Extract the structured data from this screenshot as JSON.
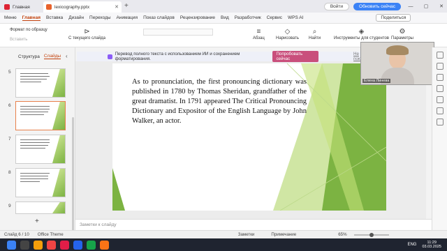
{
  "titlebar": {
    "home_tab": "Главная",
    "file_tab": "lexicography.pptx",
    "login": "Войти",
    "update": "Обновить сейчас"
  },
  "menu": {
    "items": [
      "Меню",
      "Главная",
      "Вставка",
      "Дизайн",
      "Переходы",
      "Анимация",
      "Показ слайдов",
      "Рецензирование",
      "Вид",
      "Разработчик",
      "Сервис",
      "WPS AI"
    ],
    "share": "Поделиться"
  },
  "ribbon": {
    "format_painter": "Формат по образцу",
    "paste": "Вставить",
    "from_current": "С текущего слайда",
    "paragraph": "Абзац",
    "draw": "Нарисовать",
    "find": "Найти",
    "tools_students": "Инструменты для студентов",
    "parameters": "Параметры"
  },
  "left_panel": {
    "tabs": [
      "Структура",
      "Слайды"
    ],
    "slide_numbers": [
      "5",
      "6",
      "7",
      "8",
      "9"
    ]
  },
  "notice": {
    "text": "Перевод полного текста с использованием ИИ и сохранением форматирования.",
    "button": "Попробовать сейчас",
    "dismiss": "Не показ"
  },
  "slide": {
    "body": "As to pronunciation, the first pronouncing dictionary was published in 1780 by Thomas Sheridan, grandfather of the great dramatist. In 1791 appeared The Critical Pronouncing Dictionary and Expositor of the English Language by John Walker, an actor."
  },
  "video": {
    "name": "Елена Линева"
  },
  "notes": {
    "placeholder": "Заметки к слайду"
  },
  "status": {
    "slide_counter": "Слайд 6 / 10",
    "theme": "Office Theme",
    "notes_btn": "Заметки",
    "comments_btn": "Примечание",
    "zoom": "65%"
  },
  "taskbar": {
    "lang": "ENG",
    "time": "11:29",
    "date": "03.03.2025"
  },
  "colors": {
    "accent": "#c2410c",
    "update": "#3b82f6",
    "slide_green": "#7cb342"
  }
}
